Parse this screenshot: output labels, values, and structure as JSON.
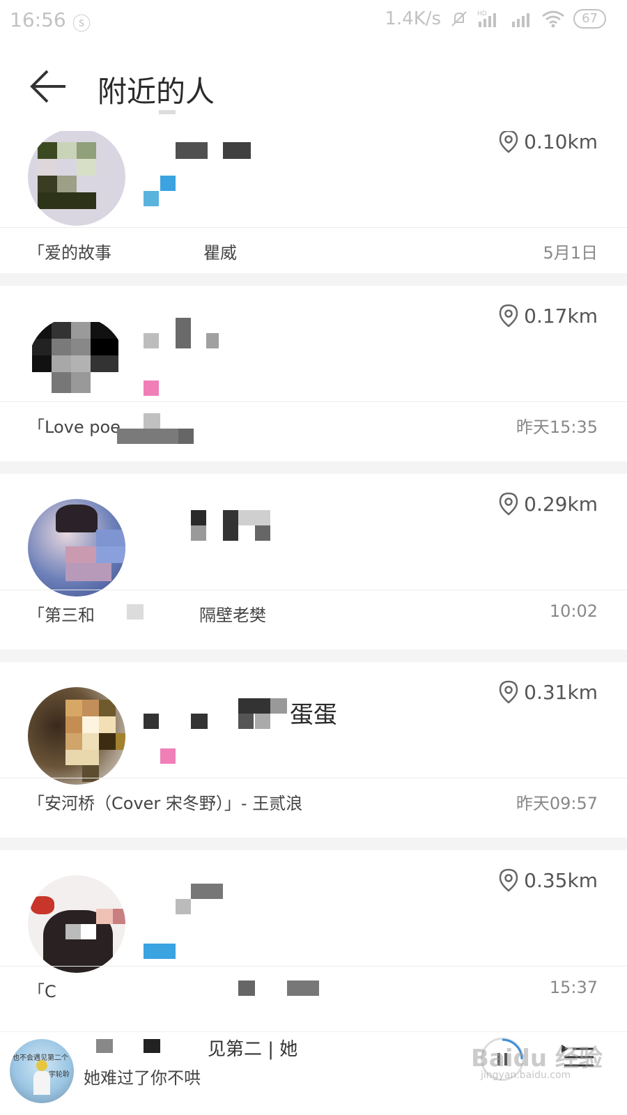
{
  "status": {
    "time": "16:56",
    "net_speed": "1.4K/s",
    "battery": "67",
    "hd_label": "HD"
  },
  "header": {
    "title": "附近的人",
    "back_icon": "arrow-left-icon"
  },
  "users": [
    {
      "distance": "0.10km",
      "song": "「爱的故事",
      "song_tail": "瞿威",
      "time": "5月1日",
      "name_suffix": "",
      "gender_color": "#3aa3e0"
    },
    {
      "distance": "0.17km",
      "song": "「Love poe",
      "song_tail": "",
      "time": "昨天15:35",
      "name_suffix": "",
      "gender_color": "#f07fb8"
    },
    {
      "distance": "0.29km",
      "song": "「第三和",
      "song_tail": "隔壁老樊",
      "time": "10:02",
      "name_suffix": "",
      "gender_color": ""
    },
    {
      "distance": "0.31km",
      "song": "「安河桥（Cover 宋冬野）」- 王贰浪",
      "song_tail": "",
      "time": "昨天09:57",
      "name_suffix": "蛋蛋",
      "gender_color": "#f07fb8"
    },
    {
      "distance": "0.35km",
      "song": "「C",
      "song_tail": "",
      "time": "15:37",
      "name_suffix": "",
      "gender_color": "#3aa3e0"
    }
  ],
  "player": {
    "title_visible": "见第二 | 她",
    "subtitle": "她难过了你不哄",
    "cover_text_1": "也不会遇见第二个",
    "cover_text_2": "宇轮聆",
    "play_icon": "play-progress-icon",
    "playlist_icon": "playlist-icon"
  },
  "watermark": "Baidu 经验",
  "watermark_url": "jingyan.baidu.com",
  "colors": {
    "accent_blue": "#3aa3e0",
    "accent_pink": "#f07fb8",
    "separator": "#f4f4f4"
  }
}
